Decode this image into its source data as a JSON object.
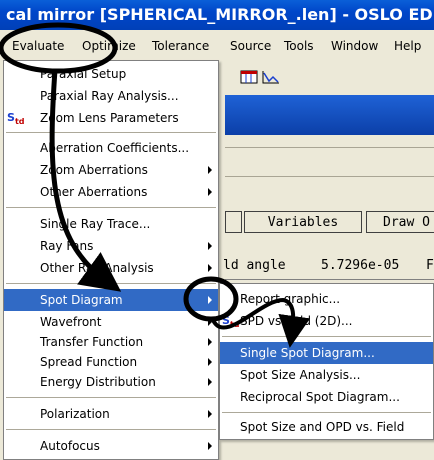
{
  "window": {
    "title": "cal mirror [SPHERICAL_MIRROR_.len] - OSLO EDU"
  },
  "menubar": {
    "items": [
      "Evaluate",
      "Optimize",
      "Tolerance",
      "Source",
      "Tools",
      "Window",
      "Help"
    ]
  },
  "background": {
    "buttons": [
      "",
      "Variables",
      "Draw O"
    ],
    "field_label": "ld angle",
    "field_value": "5.7296e-05",
    "field_suffix": "F"
  },
  "evaluate_menu": {
    "std_icon": "S",
    "std_icon_sub": "td",
    "items": [
      {
        "label": "Paraxial Setup",
        "arrow": false
      },
      {
        "label": "Paraxial Ray Analysis...",
        "arrow": false
      },
      {
        "label": "Zoom Lens Parameters",
        "arrow": false
      },
      {
        "label": "Aberration Coefficients...",
        "arrow": false
      },
      {
        "label": "Zoom Aberrations",
        "arrow": true
      },
      {
        "label": "Other Aberrations",
        "arrow": true
      },
      {
        "label": "Single Ray Trace...",
        "arrow": false
      },
      {
        "label": "Ray Fans",
        "arrow": true
      },
      {
        "label": "Other Ray Analysis",
        "arrow": true
      },
      {
        "label": "Spot Diagram",
        "arrow": true
      },
      {
        "label": "Wavefront",
        "arrow": true
      },
      {
        "label": "Transfer Function",
        "arrow": true
      },
      {
        "label": "Spread Function",
        "arrow": true
      },
      {
        "label": "Energy Distribution",
        "arrow": true
      },
      {
        "label": "Polarization",
        "arrow": true
      },
      {
        "label": "Autofocus",
        "arrow": true
      }
    ]
  },
  "spot_submenu": {
    "std_icon": "S",
    "std_icon_sub": "td",
    "items": [
      {
        "label": "Report graphic..."
      },
      {
        "label": "SPD vs field (2D)..."
      },
      {
        "label": "Single Spot Diagram..."
      },
      {
        "label": "Spot Size Analysis..."
      },
      {
        "label": "Reciprocal Spot Diagram..."
      },
      {
        "label": "Spot Size and OPD vs. Field"
      }
    ]
  },
  "colors": {
    "title_bar": "#0046c9",
    "highlight": "#316ac5",
    "annotation": "#000000"
  }
}
